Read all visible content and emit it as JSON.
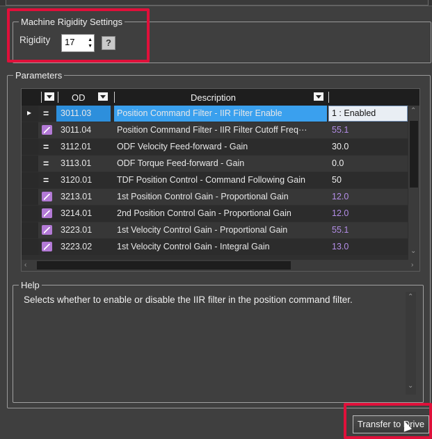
{
  "rigidity": {
    "group_title": "Machine Rigidity Settings",
    "label": "Rigidity",
    "value": "17",
    "help_button": "?"
  },
  "parameters": {
    "group_title": "Parameters",
    "columns": {
      "od": "OD",
      "description": "Description"
    },
    "rows": [
      {
        "od": "3011.03",
        "description": "Position Command Filter - IIR Filter Enable",
        "value": "1 : Enabled",
        "icon": "equals-icon",
        "selected": true
      },
      {
        "od": "3011.04",
        "description": "Position Command Filter - IIR Filter Cutoff Freq···",
        "value": "55.1",
        "icon": "edit-icon"
      },
      {
        "od": "3112.01",
        "description": "ODF Velocity Feed-forward - Gain",
        "value": "30.0",
        "icon": "equals-icon"
      },
      {
        "od": "3113.01",
        "description": "ODF Torque Feed-forward - Gain",
        "value": "0.0",
        "icon": "equals-icon"
      },
      {
        "od": "3120.01",
        "description": "TDF Position Control - Command Following Gain",
        "value": "50",
        "icon": "equals-icon"
      },
      {
        "od": "3213.01",
        "description": "1st Position Control Gain - Proportional Gain",
        "value": "12.0",
        "icon": "edit-icon"
      },
      {
        "od": "3214.01",
        "description": "2nd Position Control Gain - Proportional Gain",
        "value": "12.0",
        "icon": "edit-icon"
      },
      {
        "od": "3223.01",
        "description": "1st Velocity Control Gain - Proportional Gain",
        "value": "55.1",
        "icon": "edit-icon"
      },
      {
        "od": "3223.02",
        "description": "1st Velocity Control Gain - Integral Gain",
        "value": "13.0",
        "icon": "edit-icon"
      }
    ]
  },
  "help": {
    "group_title": "Help",
    "text": "Selects whether to enable or disable the IIR filter in the position command filter."
  },
  "transfer_button": "Transfer to Drive",
  "colors": {
    "highlight": "#e0103a",
    "selection": "#3aa0ee",
    "modified_value": "#b48ee8"
  }
}
